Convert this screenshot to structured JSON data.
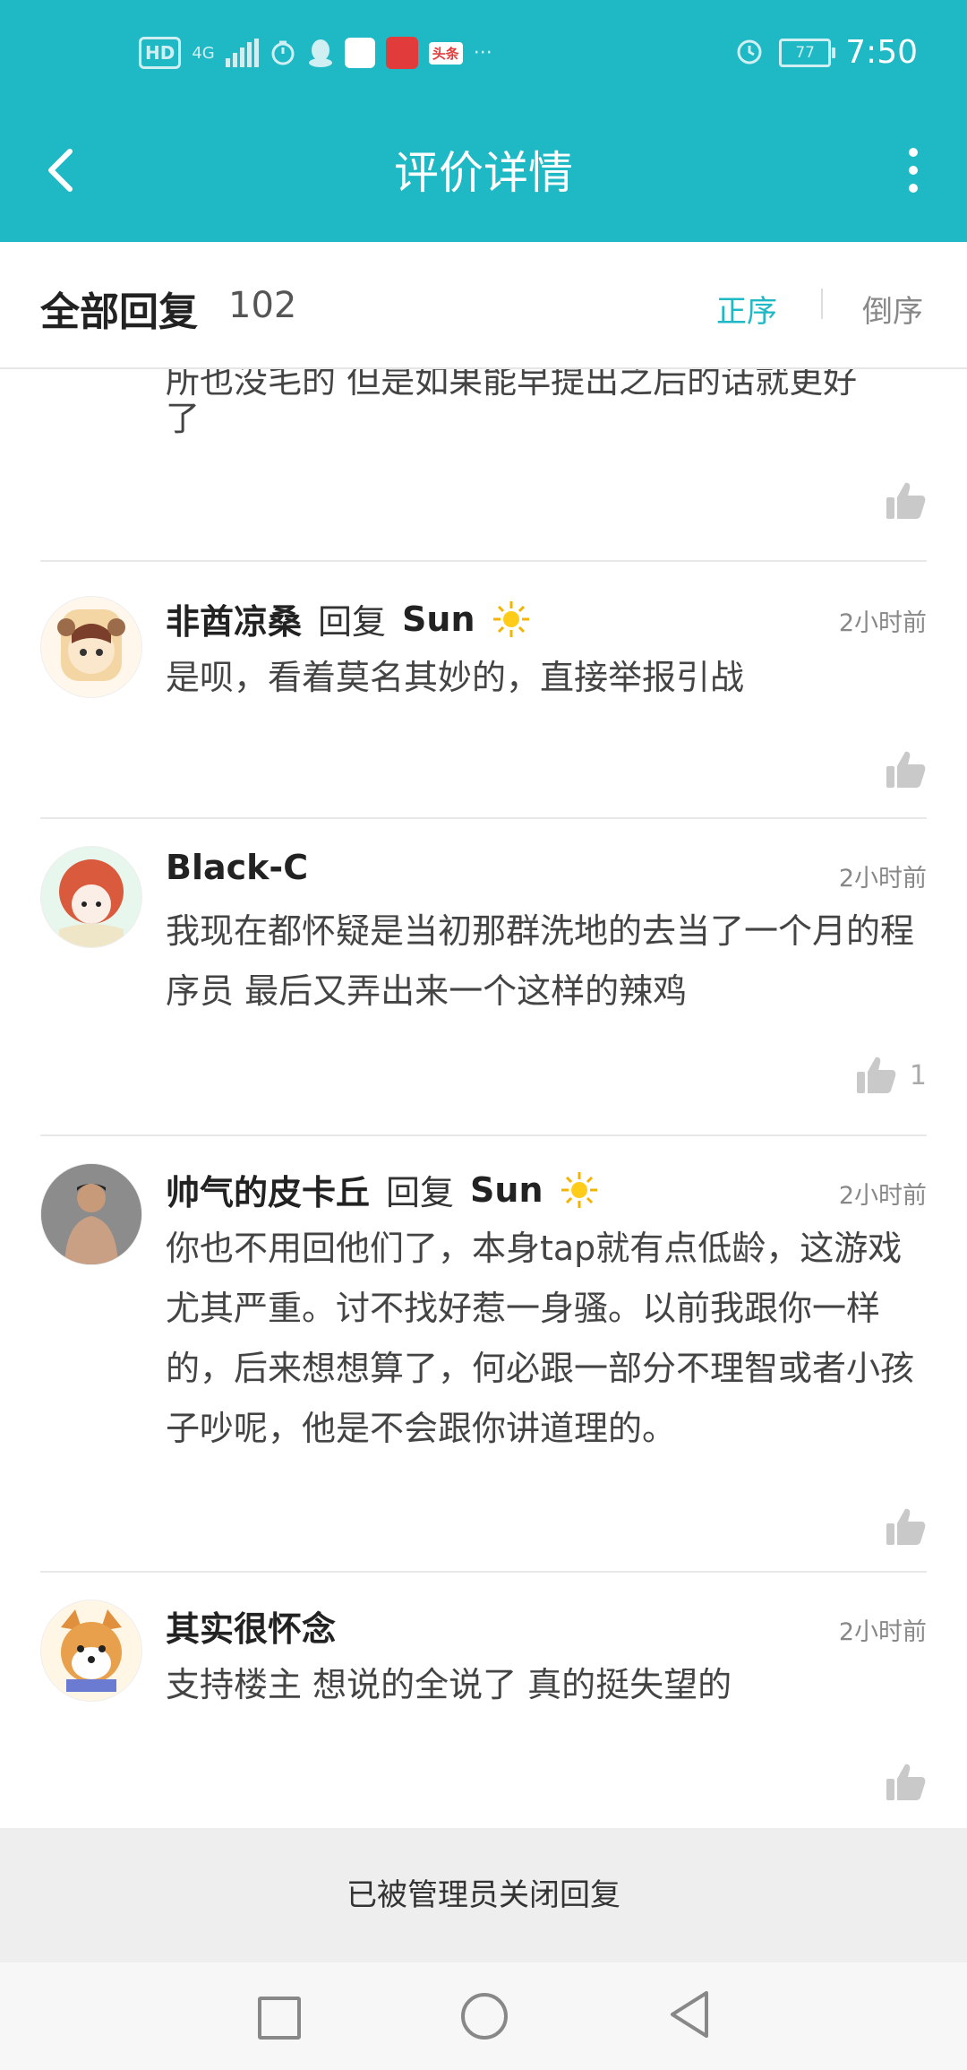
{
  "status_bar": {
    "left_badges": {
      "hd": "HD",
      "network": "4G"
    },
    "battery": "77",
    "time": "7:50"
  },
  "header": {
    "title": "评价详情"
  },
  "replies_header": {
    "title": "全部回复",
    "count": "102",
    "sort_asc": "正序",
    "sort_desc": "倒序"
  },
  "partial_reply": {
    "cut_line": "所也没毛的 但是如果能早提出之后的话就更好",
    "last_line": "了"
  },
  "replies": [
    {
      "name": "非酋凉桑",
      "reply_word": "回复",
      "reply_to": "Sun",
      "time": "2小时前",
      "content": "是呗，看着莫名其妙的，直接举报引战",
      "likes": ""
    },
    {
      "name": "Black-C",
      "reply_word": "",
      "reply_to": "",
      "time": "2小时前",
      "content": "我现在都怀疑是当初那群洗地的去当了一个月的程序员   最后又弄出来一个这样的辣鸡",
      "likes": "1"
    },
    {
      "name": "帅气的皮卡丘",
      "reply_word": "回复",
      "reply_to": "Sun",
      "time": "2小时前",
      "content": "你也不用回他们了，本身tap就有点低龄，这游戏尤其严重。讨不找好惹一身骚。以前我跟你一样的，后来想想算了，何必跟一部分不理智或者小孩子吵呢，他是不会跟你讲道理的。",
      "likes": ""
    },
    {
      "name": "其实很怀念",
      "reply_word": "",
      "reply_to": "",
      "time": "2小时前",
      "content": "支持楼主  想说的全说了  真的挺失望的",
      "likes": ""
    }
  ],
  "closed_notice": "已被管理员关闭回复",
  "colors": {
    "accent": "#1fb8c5",
    "text_primary": "#222222",
    "text_secondary": "#888888"
  }
}
